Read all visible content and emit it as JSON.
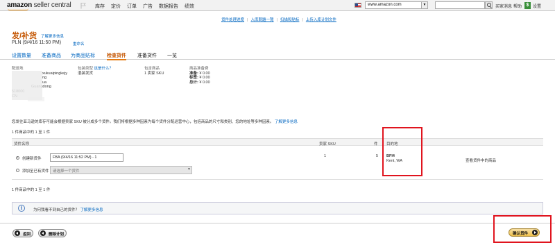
{
  "header": {
    "logo_main": "amazon",
    "logo_sub": " seller central",
    "nav": [
      "库存",
      "定价",
      "订单",
      "广告",
      "数据报告",
      "绩效"
    ],
    "marketplace": "www.amazon.com",
    "links": {
      "messages": "买家消息",
      "help": "帮助",
      "settings": "设置"
    },
    "dollar": "$"
  },
  "sublinks": [
    "货件处理进度",
    "入库問題一覽",
    "扫描和貼标",
    "上传入库计划文件"
  ],
  "page": {
    "title": "发/补货",
    "learn_more": "了解更多信息",
    "plan_name": "PLN (9/4/16 11:50 PM)",
    "rename": "重命名"
  },
  "steps": [
    "设置数量",
    "准备商品",
    "为商品贴标",
    "检查货件",
    "准备货件",
    "一览"
  ],
  "info": {
    "ship_from_label": "配送地",
    "ship_from_lines": [
      "xukuaipingkejy",
      "",
      "ng",
      "ua",
      "Guangdong",
      "518000",
      "CN"
    ],
    "pack_label": "包装类型",
    "pack_link": "这是什么？",
    "pack_value": "混装发货",
    "contents_label": "包含商品",
    "contents_value": "1 卖家 SKU",
    "prep_label": "商品准备费",
    "fees": [
      {
        "label": "准备:",
        "value": "¥ 0.00"
      },
      {
        "label": "标签:",
        "value": "¥ 0.00"
      },
      {
        "label": "总计:",
        "value": "¥ 0.00"
      }
    ]
  },
  "note": {
    "text": "您发往亚马逊的库存可能会根据卖家 SKU 被分成多个货件。我们将根据多种因素为每个货件分配运营中心，包括商品的尺寸和类别、您的地址等多种因素。",
    "link": "了解更多信息"
  },
  "count_top": "1 件商品中的 1 至 1 件",
  "count_bottom": "1 件商品中的 1 至 1 件",
  "table": {
    "headers": {
      "name": "货件名称",
      "sku": "卖家 SKU",
      "units": "件",
      "destination": "目的地"
    },
    "create_label": "创建新货件",
    "create_value": "FBA (9/4/16 11:52 PM) - 1",
    "add_label": "添加至已有货件",
    "add_placeholder": "请选择一个货件",
    "sku_count": "1",
    "units": "5",
    "dest_code": "BFI4",
    "dest_city": "Kent, WA",
    "view_link": "查看货件中的商品"
  },
  "help": {
    "question": "为何我看不到自己的货件？",
    "link": "了解更多信息"
  },
  "buttons": {
    "back": "返回",
    "delete": "删除计划",
    "confirm": "确认货件"
  }
}
